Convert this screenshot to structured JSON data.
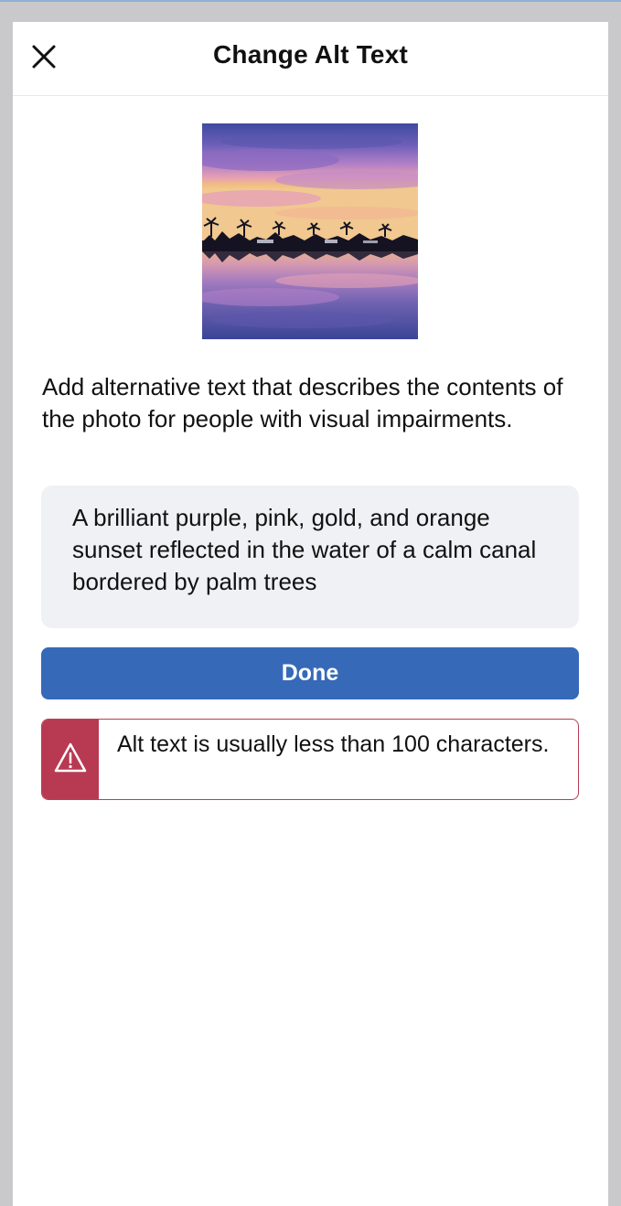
{
  "header": {
    "title": "Change Alt Text",
    "close_icon": "close-icon"
  },
  "photo": {
    "subject_icon": "sunset-photo"
  },
  "instructions": "Add alternative text that describes the contents of the photo for people with visual impairments.",
  "alt_text_field": {
    "value": "A brilliant purple, pink, gold, and orange sunset reflected in the water of a calm canal bordered by palm trees"
  },
  "done_button": {
    "label": "Done"
  },
  "warning": {
    "icon": "warning-triangle-icon",
    "message": "Alt text is usually less than 100 characters."
  },
  "colors": {
    "accent": "#3669b8",
    "warning": "#b83a52",
    "input_bg": "#eff1f4",
    "backdrop": "#c9c9cb"
  }
}
